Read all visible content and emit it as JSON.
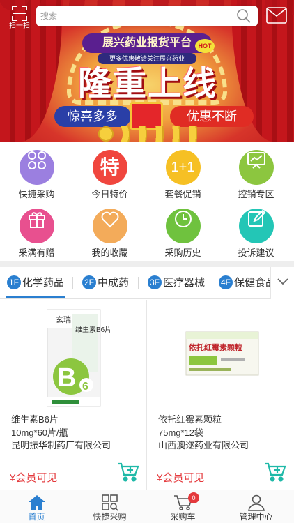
{
  "header": {
    "scan_label": "扫一扫",
    "search_placeholder": "搜索"
  },
  "banner": {
    "platform_title": "展兴药业报货平台",
    "platform_subtitle": "更多优惠敬请关注展兴药业",
    "hot_badge": "HOT",
    "slogan": "隆重上线",
    "pill_left": "惊喜多多",
    "pill_right": "优惠不断"
  },
  "quick_menu": [
    {
      "label": "快捷采购",
      "icon": "clover-icon",
      "color": "#9b7fe0"
    },
    {
      "label": "今日特价",
      "icon": "special-price-icon",
      "color": "#f0463e"
    },
    {
      "label": "套餐促销",
      "icon": "bundle-icon",
      "color": "#f6c024"
    },
    {
      "label": "控销专区",
      "icon": "chart-board-icon",
      "color": "#8cc63f"
    },
    {
      "label": "采满有赠",
      "icon": "gift-icon",
      "color": "#e8508f"
    },
    {
      "label": "我的收藏",
      "icon": "heart-icon",
      "color": "#f3ab5a"
    },
    {
      "label": "采购历史",
      "icon": "history-icon",
      "color": "#6fc23e"
    },
    {
      "label": "投诉建议",
      "icon": "feedback-icon",
      "color": "#23c6b6"
    }
  ],
  "special_icon_text": "特",
  "bundle_icon_text": "1+1",
  "category_tabs": [
    {
      "num": "1F",
      "label": "化学药品"
    },
    {
      "num": "2F",
      "label": "中成药"
    },
    {
      "num": "3F",
      "label": "医疗器械"
    },
    {
      "num": "4F",
      "label": "保健食品"
    }
  ],
  "products": [
    {
      "name": "维生素B6片",
      "spec": "10mg*60片/瓶",
      "maker": "昆明振华制药厂有限公司",
      "price": "¥会员可见",
      "box_title": "维生素B6片",
      "box_brand": "玄瑞",
      "box_letter": "B",
      "box_sub": "6"
    },
    {
      "name": "依托红霉素颗粒",
      "spec": "75mg*12袋",
      "maker": "山西澳迩药业有限公司",
      "price": "¥会员可见",
      "box_title": "依托红霉素颗粒"
    }
  ],
  "bottom_nav": [
    {
      "label": "首页",
      "active": true
    },
    {
      "label": "快捷采购",
      "active": false
    },
    {
      "label": "采购车",
      "active": false,
      "badge": "0"
    },
    {
      "label": "管理中心",
      "active": false
    }
  ],
  "colors": {
    "accent": "#2a7fd0",
    "price": "#e4393c",
    "cart_teal": "#1fb9a8"
  }
}
